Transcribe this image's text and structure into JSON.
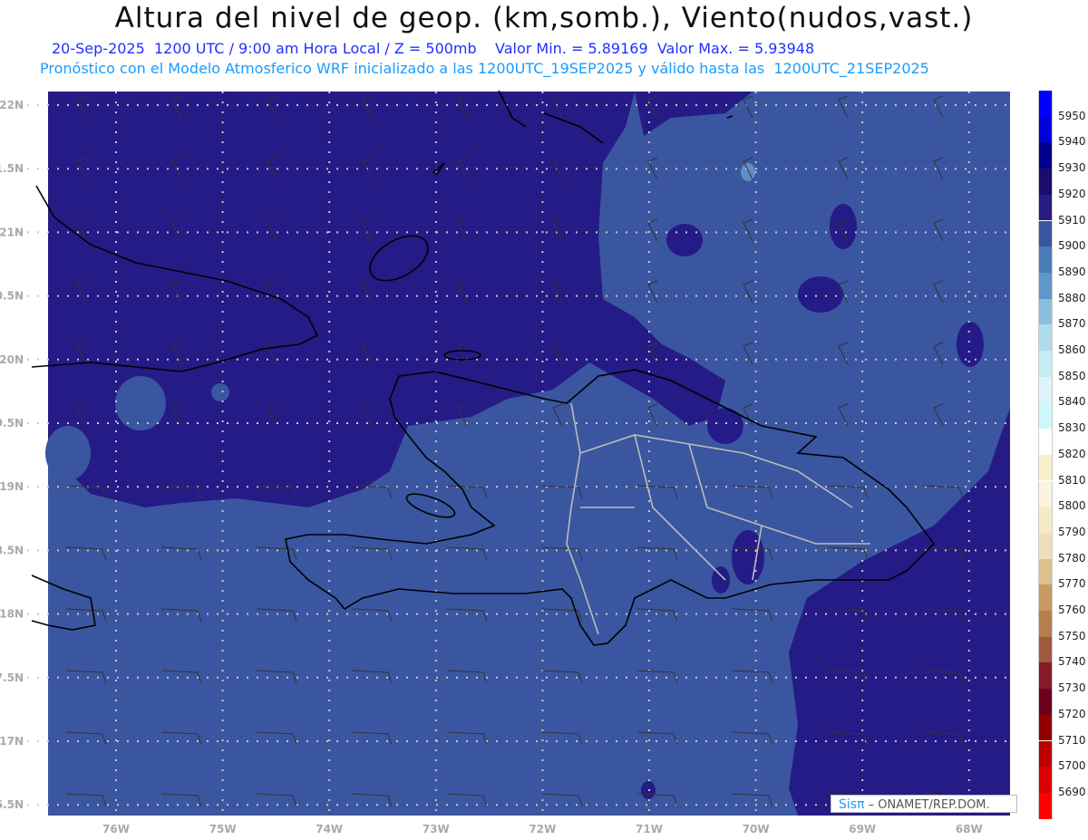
{
  "header": {
    "title": "Altura del nivel de geop. (km,somb.), Viento(nudos,vast.)",
    "subtitle_date": "20-Sep-2025  1200 UTC / 9:00 am Hora Local / Z = 500mb    Valor Min. = 5.89169  Valor Max. = 5.93948",
    "subtitle_model": "Pronóstico con el Modelo Atmosferico WRF inicializado a las 1200UTC_19SEP2025 y válido hasta las  1200UTC_21SEP2025"
  },
  "axes": {
    "lon_labels": [
      "76W",
      "75W",
      "74W",
      "73W",
      "72W",
      "71W",
      "70W",
      "69W",
      "68W"
    ],
    "lat_labels": [
      "22N",
      "1.5N",
      "21N",
      "0.5N",
      "20N",
      "9.5N",
      "19N",
      "8.5N",
      "18N",
      "7.5N",
      "17N",
      "6.5N"
    ]
  },
  "colorbar": {
    "labels": [
      "5950",
      "5940",
      "5930",
      "5920",
      "5910",
      "5900",
      "5890",
      "5880",
      "5870",
      "5860",
      "5850",
      "5840",
      "5830",
      "5820",
      "5810",
      "5800",
      "5790",
      "5780",
      "5770",
      "5760",
      "5750",
      "5740",
      "5730",
      "5720",
      "5710",
      "5700",
      "5690"
    ],
    "colors": [
      "#0000ff",
      "#0000dd",
      "#00008c",
      "#1c0a6c",
      "#271c82",
      "#3a55a0",
      "#4a7cb8",
      "#5f98c8",
      "#8cbedc",
      "#b0dcea",
      "#c4ecf3",
      "#dcf4f8",
      "#ccf8fb",
      "#ffffff",
      "#f7f1cc",
      "#faf4e0",
      "#f5ecc6",
      "#ede0b8",
      "#dcc08e",
      "#c69a62",
      "#b67d4e",
      "#a05840",
      "#861a28",
      "#6c001c",
      "#940000",
      "#bc0000",
      "#dc0000",
      "#ff0000"
    ]
  },
  "fill_colors": {
    "high": "#251b86",
    "mid": "#3a56a0",
    "light": "#5f8ec4"
  },
  "credit": {
    "logo": "Sisπ",
    "text": "– ONAMET/REP.DOM."
  }
}
